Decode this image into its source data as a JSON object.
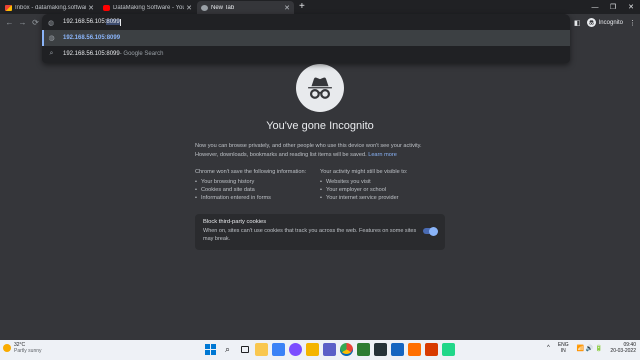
{
  "tabs": [
    {
      "label": "Inbox - datamaking.software@gmail.com",
      "favicon": "gmail-icon",
      "active": false
    },
    {
      "label": "DataMaking Software - YouTube",
      "favicon": "youtube-icon",
      "active": false
    },
    {
      "label": "New Tab",
      "favicon": "incognito-icon",
      "active": true
    }
  ],
  "new_tab_symbol": "+",
  "window_controls": {
    "minimize": "—",
    "maximize": "❐",
    "close": "✕"
  },
  "toolbar": {
    "back": "←",
    "forward": "→",
    "reload": "⟳",
    "incognito_label": "Incognito",
    "menu": "⋮",
    "sidepanel": "◧"
  },
  "omnibox": {
    "typed": "192.168.56.105:",
    "autocomplete": "8099",
    "suggestions": [
      {
        "text": "192.168.56.105:8099",
        "hint": "",
        "icon": "globe-icon",
        "selected": true
      },
      {
        "text": "192.168.56.105:8099",
        "hint": " - Google Search",
        "icon": "search-icon",
        "selected": false
      }
    ]
  },
  "page": {
    "heading": "You've gone Incognito",
    "intro": "Now you can browse privately, and other people who use this device won't see your activity. However, downloads, bookmarks and reading list items will be saved.",
    "learn_more": "Learn more",
    "wont_save_title": "Chrome won't save the following information:",
    "wont_save": [
      "Your browsing history",
      "Cookies and site data",
      "Information entered in forms"
    ],
    "visible_title": "Your activity might still be visible to:",
    "visible": [
      "Websites you visit",
      "Your employer or school",
      "Your internet service provider"
    ],
    "cookies_title": "Block third-party cookies",
    "cookies_desc": "When on, sites can't use cookies that track you across the web. Features on some sites may break.",
    "cookies_toggle_on": true
  },
  "taskbar": {
    "temperature": "32°C",
    "condition": "Partly sunny",
    "apps": [
      "windows-start",
      "search",
      "task-view",
      "file-explorer",
      "store",
      "video",
      "folder",
      "teams",
      "chrome",
      "green-app",
      "media",
      "virtualbox",
      "orange-app",
      "office",
      "pycharm"
    ],
    "chevron": "^",
    "lang_line1": "ENG",
    "lang_line2": "IN",
    "sys_icons": "📶 🔊 🔋",
    "time": "09:40",
    "date": "20-03-2022"
  },
  "colors": {
    "tab_strip": "#202124",
    "toolbar": "#35363a",
    "page_bg": "#35363a",
    "link": "#8ab4f8",
    "taskbar": "#eef1f6"
  }
}
